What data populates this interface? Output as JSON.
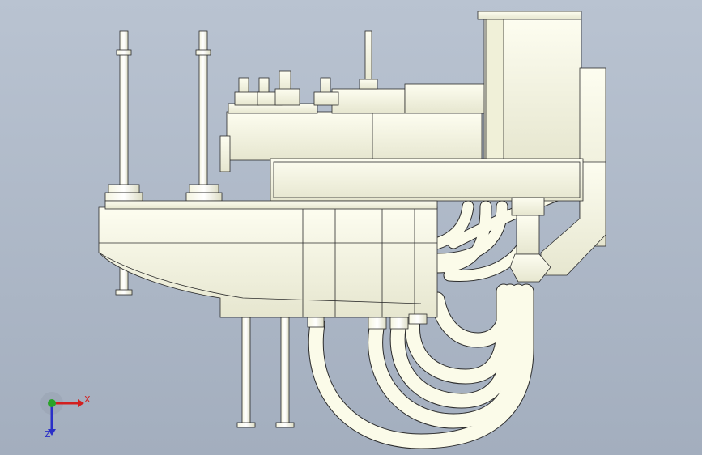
{
  "triad": {
    "x_label": "X",
    "z_label": "Z",
    "x_color": "#d21f1f",
    "y_color": "#29a329",
    "z_color": "#2a2fc8"
  },
  "model": {
    "background_top": "#b9c3d1",
    "background_bottom": "#a3aebe",
    "part_fill": "#fbfbe9",
    "edge_color": "#2b2b2b"
  }
}
